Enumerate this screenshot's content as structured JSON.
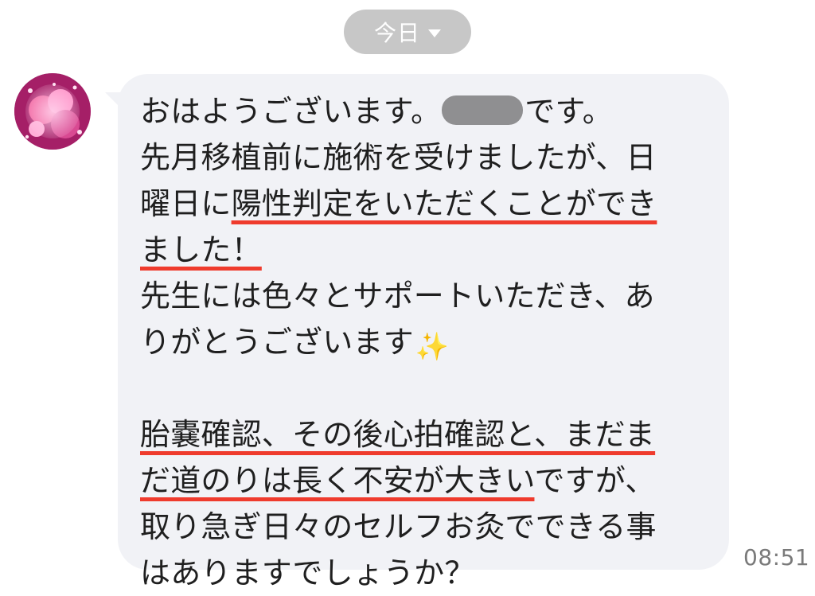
{
  "header": {
    "date_label": "今日"
  },
  "message": {
    "line1_before": "おはようございます。",
    "line1_after": "です。",
    "line2": "先月移植前に施術を受けましたが、日",
    "line3_prefix": "曜日に",
    "line3_highlight": "陽性判定をいただくことができ",
    "line4_highlight": "ました！",
    "line5": "先生には色々とサポートいただき、あ",
    "line6_text": "りがとうございます",
    "line6_emoji": "✨",
    "line8_highlight": "胎嚢確認、その後心拍確認と、まだま",
    "line9_highlight": "だ道のりは長く不安が大きい",
    "line9_suffix": "ですが、",
    "line10": "取り急ぎ日々のセルフお灸でできる事",
    "line11": "はありますでしょうか？",
    "timestamp": "08:51"
  },
  "colors": {
    "pill_bg": "#c7c7c7",
    "bubble_bg": "#f1f2f6",
    "text": "#1f1f1f",
    "underline": "#ef3b2d",
    "timestamp": "#7a7a7a",
    "redaction": "#8f8f91"
  },
  "icons": {
    "date_dropdown": "chevron-down-icon",
    "emoji": "sparkles-icon"
  }
}
